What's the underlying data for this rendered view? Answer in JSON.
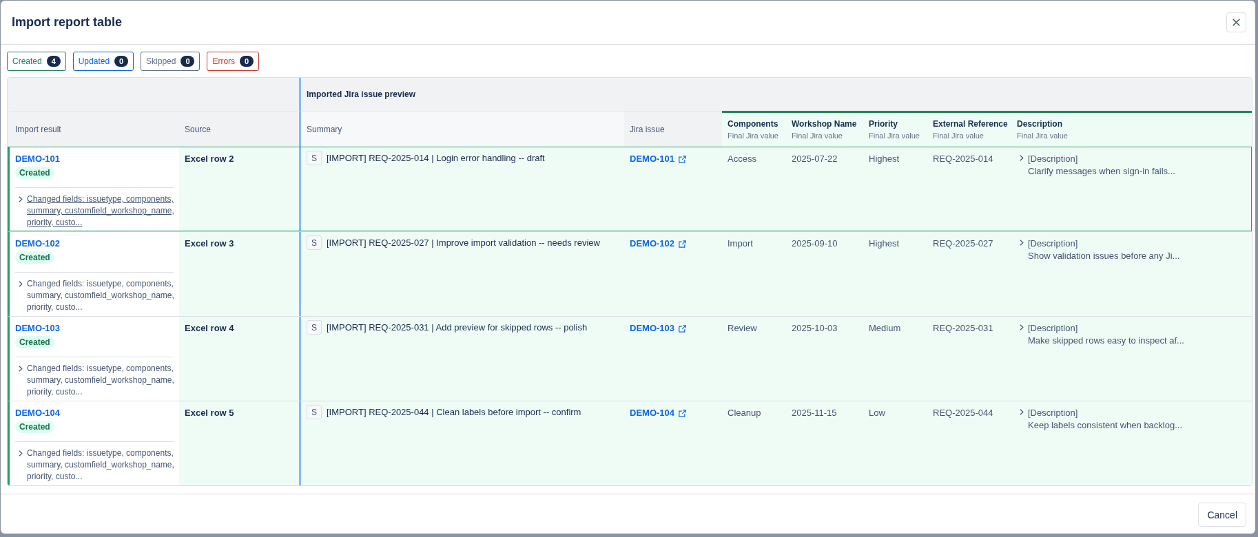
{
  "dialog": {
    "title": "Import report table"
  },
  "filters": [
    {
      "label": "Created",
      "count": "4",
      "color": "#1f845a"
    },
    {
      "label": "Updated",
      "count": "0",
      "color": "#0c66e4"
    },
    {
      "label": "Skipped",
      "count": "0",
      "color": "#626f86"
    },
    {
      "label": "Errors",
      "count": "0",
      "color": "#c9372c"
    }
  ],
  "table": {
    "group_header": "Imported Jira issue preview",
    "columns": [
      {
        "label": "Import result",
        "kind": "meta"
      },
      {
        "label": "Source",
        "kind": "meta"
      },
      {
        "label": "Summary",
        "kind": "preview"
      },
      {
        "label": "Jira issue",
        "kind": "preview"
      },
      {
        "label": "Components",
        "kind": "final",
        "subtitle": "Final Jira value"
      },
      {
        "label": "Workshop Name",
        "kind": "final",
        "subtitle": "Final Jira value"
      },
      {
        "label": "Priority",
        "kind": "final",
        "subtitle": "Final Jira value"
      },
      {
        "label": "External Reference",
        "kind": "final",
        "subtitle": "Final Jira value"
      },
      {
        "label": "Description",
        "kind": "final",
        "subtitle": "Final Jira value"
      }
    ],
    "rows": [
      {
        "selected": true,
        "key": "DEMO-101",
        "status": {
          "label": "Created",
          "kind": "created"
        },
        "changes": {
          "text": "Changed fields: issuetype, components, summary, customfield_workshop_name, priority, custo...",
          "expanded": false,
          "hovered": true
        },
        "source": "Excel row 2",
        "issue_type": "S",
        "summary": "[IMPORT] REQ-2025-014 | Login error handling -- draft",
        "jira_issue": "DEMO-101",
        "components": "Access",
        "workshop_name": "2025-07-22",
        "priority": "Highest",
        "external_reference": "REQ-2025-014",
        "description": {
          "label": "[Description]",
          "text": "Clarify messages when sign-in fails...",
          "expanded": false
        }
      },
      {
        "selected": false,
        "key": "DEMO-102",
        "status": {
          "label": "Created",
          "kind": "created"
        },
        "changes": {
          "text": "Changed fields: issuetype, components, summary, customfield_workshop_name, priority, custo...",
          "expanded": false,
          "hovered": false
        },
        "source": "Excel row 3",
        "issue_type": "S",
        "summary": "[IMPORT] REQ-2025-027 | Improve import validation -- needs review",
        "jira_issue": "DEMO-102",
        "components": "Import",
        "workshop_name": "2025-09-10",
        "priority": "Highest",
        "external_reference": "REQ-2025-027",
        "description": {
          "label": "[Description]",
          "text": "Show validation issues before any Ji...",
          "expanded": false
        }
      },
      {
        "selected": false,
        "key": "DEMO-103",
        "status": {
          "label": "Created",
          "kind": "created"
        },
        "changes": {
          "text": "Changed fields: issuetype, components, summary, customfield_workshop_name, priority, custo...",
          "expanded": false,
          "hovered": false
        },
        "source": "Excel row 4",
        "issue_type": "S",
        "summary": "[IMPORT] REQ-2025-031 | Add preview for skipped rows -- polish",
        "jira_issue": "DEMO-103",
        "components": "Review",
        "workshop_name": "2025-10-03",
        "priority": "Medium",
        "external_reference": "REQ-2025-031",
        "description": {
          "label": "[Description]",
          "text": "Make skipped rows easy to inspect af...",
          "expanded": false
        }
      },
      {
        "selected": false,
        "key": "DEMO-104",
        "status": {
          "label": "Created",
          "kind": "created"
        },
        "changes": {
          "text": "Changed fields: issuetype, components, summary, customfield_workshop_name, priority, custo...",
          "expanded": false,
          "hovered": false
        },
        "source": "Excel row 5",
        "issue_type": "S",
        "summary": "[IMPORT] REQ-2025-044 | Clean labels before import -- confirm",
        "jira_issue": "DEMO-104",
        "components": "Cleanup",
        "workshop_name": "2025-11-15",
        "priority": "Low",
        "external_reference": "REQ-2025-044",
        "description": {
          "label": "[Description]",
          "text": "Keep labels consistent when backlog...",
          "expanded": false
        }
      }
    ]
  },
  "footer": {
    "buttons": [
      "Cancel"
    ]
  }
}
